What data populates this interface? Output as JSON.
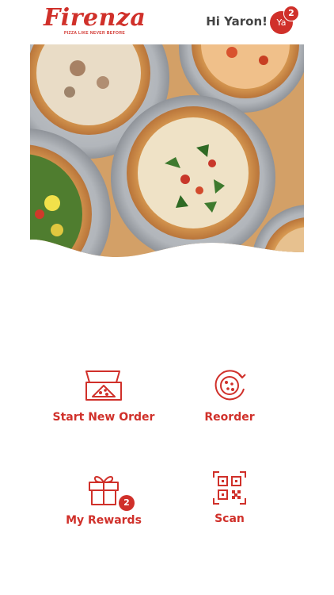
{
  "header": {
    "logo_text": "Firenza",
    "logo_tagline": "PIZZA LIKE NEVER BEFORE",
    "greeting": "Hi Yaron!",
    "avatar_initials": "Ya",
    "notification_count": "2"
  },
  "hero": {
    "image_icon": "pizza-photo"
  },
  "actions": [
    {
      "label": "Start New Order",
      "icon": "pizza-box-icon"
    },
    {
      "label": "Reorder",
      "icon": "pizza-reorder-icon"
    },
    {
      "label": "My Rewards",
      "icon": "gift-icon",
      "badge": "2"
    },
    {
      "label": "Scan",
      "icon": "qr-code-icon"
    }
  ],
  "colors": {
    "brand_red": "#d0302a",
    "greeting_text": "#444444"
  }
}
